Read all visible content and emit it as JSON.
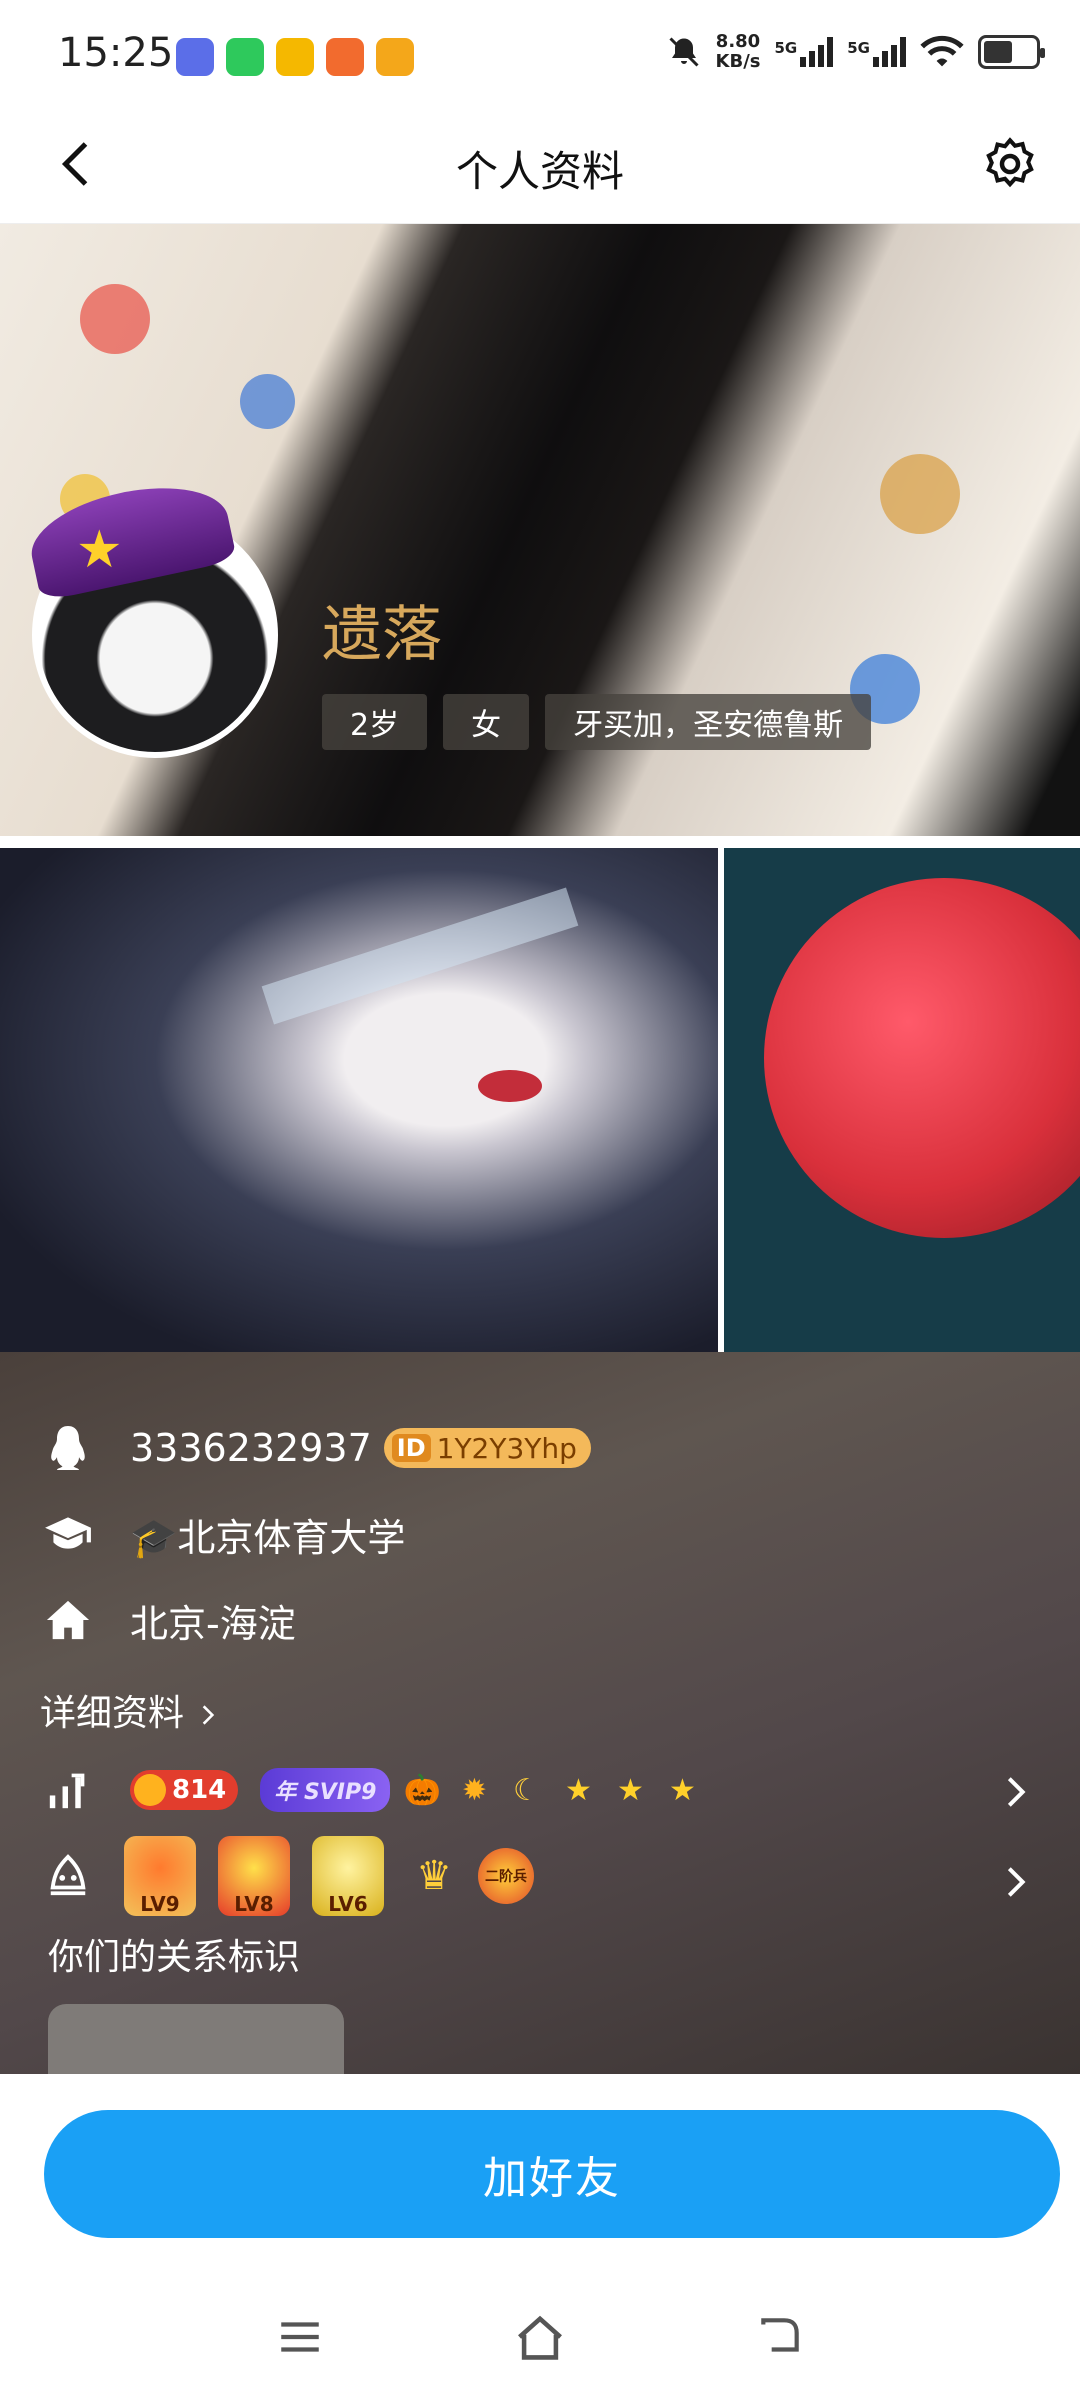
{
  "status_bar": {
    "time": "15:25",
    "net_speed_value": "8.80",
    "net_speed_unit": "KB/s",
    "sim1": "5G",
    "sim2": "5G",
    "app_icon_colors": [
      "#5b6ee8",
      "#2ec95c",
      "#f5b800",
      "#f26b2e",
      "#f4a71a"
    ]
  },
  "header": {
    "title": "个人资料",
    "back_icon": "chevron-left-icon",
    "settings_icon": "gear-icon"
  },
  "profile": {
    "nickname": "遗落",
    "tags": [
      "2岁",
      "女",
      "牙买加，圣安德鲁斯"
    ]
  },
  "info": {
    "qq_number": "3336232937",
    "id_badge_prefix": "ID",
    "id_badge_value": "1Y2Y3Yhp",
    "school_icon": "🎓",
    "school": "北京体育大学",
    "location": "北京-海淀",
    "detail_link": "详细资料",
    "coin_count": "814",
    "svip_label": "年 SVIP9",
    "badges": {
      "lv9": "LV9",
      "lv8": "LV8",
      "lv6": "LV6",
      "game": "二阶兵"
    },
    "relationship_title": "你们的关系标识"
  },
  "actions": {
    "add_friend": "加好友"
  },
  "colors": {
    "accent_blue": "#1aa0f5",
    "nickname_gold": "#d7a85c",
    "coin_red": "#e23d2d",
    "svip_purple": "#6a48e0",
    "id_badge_orange": "#f4b95a"
  }
}
